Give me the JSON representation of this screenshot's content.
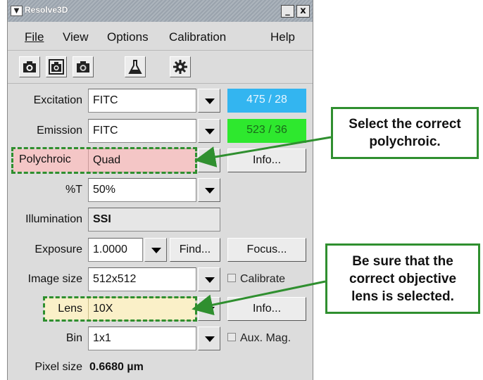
{
  "window": {
    "title": "Resolve3D",
    "minimize": "_",
    "close": "x"
  },
  "menu": [
    {
      "label": "File"
    },
    {
      "label": "View"
    },
    {
      "label": "Options"
    },
    {
      "label": "Calibration"
    },
    {
      "label": "Help"
    }
  ],
  "toolbar": [
    {
      "icon": "camera-icon"
    },
    {
      "icon": "camera-refresh-icon"
    },
    {
      "icon": "camera-alt-icon"
    },
    {
      "icon": "flask-icon"
    },
    {
      "icon": "gear-icon"
    }
  ],
  "form": {
    "excitation": {
      "label": "Excitation",
      "value": "FITC",
      "badge": "475 / 28",
      "badge_color": "#33b5f0"
    },
    "emission": {
      "label": "Emission",
      "value": "FITC",
      "badge": "523 / 36",
      "badge_color": "#2ee82e"
    },
    "polychroic": {
      "label": "Polychroic",
      "value": "Quad",
      "info": "Info..."
    },
    "transmission": {
      "label": "%T",
      "value": "50%"
    },
    "illumination": {
      "label": "Illumination",
      "value": "SSI"
    },
    "exposure": {
      "label": "Exposure",
      "value": "1.0000",
      "find": "Find...",
      "focus": "Focus..."
    },
    "image_size": {
      "label": "Image size",
      "value": "512x512",
      "calibrate": "Calibrate"
    },
    "lens": {
      "label": "Lens",
      "value": "10X",
      "info": "Info..."
    },
    "bin": {
      "label": "Bin",
      "value": "1x1",
      "aux_mag": "Aux. Mag."
    },
    "pixel_size": {
      "label": "Pixel size",
      "value": "0.6680 µm"
    }
  },
  "callouts": {
    "polychroic": {
      "line1": "Select the correct",
      "line2": "polychroic."
    },
    "lens": {
      "line1": "Be sure that the",
      "line2": "correct objective",
      "line3": "lens is selected."
    }
  },
  "colors": {
    "callout_border": "#2f8f2f",
    "polychroic_fill": "#f4c6c6",
    "lens_fill": "#faf0c8"
  }
}
